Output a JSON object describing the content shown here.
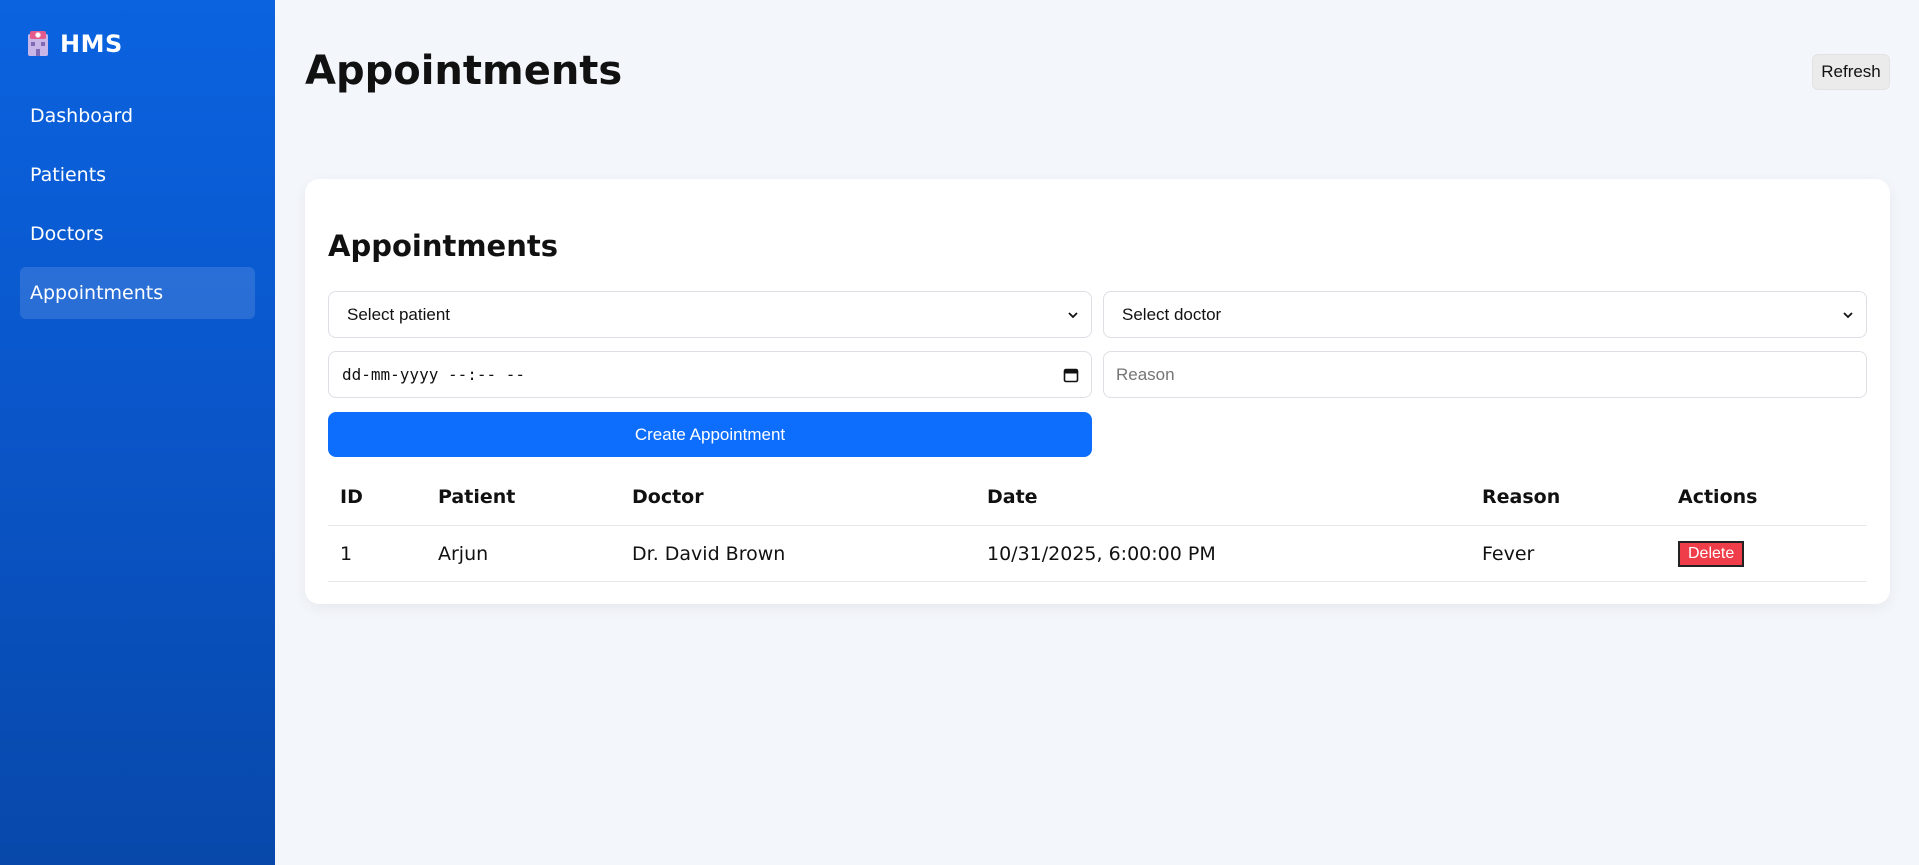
{
  "sidebar": {
    "brand": "HMS",
    "logo_icon": "hospital-building-icon",
    "items": [
      {
        "label": "Dashboard",
        "active": false
      },
      {
        "label": "Patients",
        "active": false
      },
      {
        "label": "Doctors",
        "active": false
      },
      {
        "label": "Appointments",
        "active": true
      }
    ]
  },
  "header": {
    "title": "Appointments",
    "refresh_label": "Refresh"
  },
  "card": {
    "title": "Appointments",
    "form": {
      "patient_select": "Select patient",
      "doctor_select": "Select doctor",
      "datetime_placeholder": "dd-mm-yyyy --:-- --",
      "reason_placeholder": "Reason",
      "submit_label": "Create Appointment"
    },
    "table": {
      "columns": [
        "ID",
        "Patient",
        "Doctor",
        "Date",
        "Reason",
        "Actions"
      ],
      "rows": [
        {
          "id": "1",
          "patient": "Arjun",
          "doctor": "Dr. David Brown",
          "date": "10/31/2025, 6:00:00 PM",
          "reason": "Fever",
          "action": "Delete"
        }
      ]
    }
  },
  "colors": {
    "primary": "#0d6efd",
    "sidebar": "#0a55c8",
    "danger": "#ef3e4a",
    "background": "#f3f6fb"
  }
}
